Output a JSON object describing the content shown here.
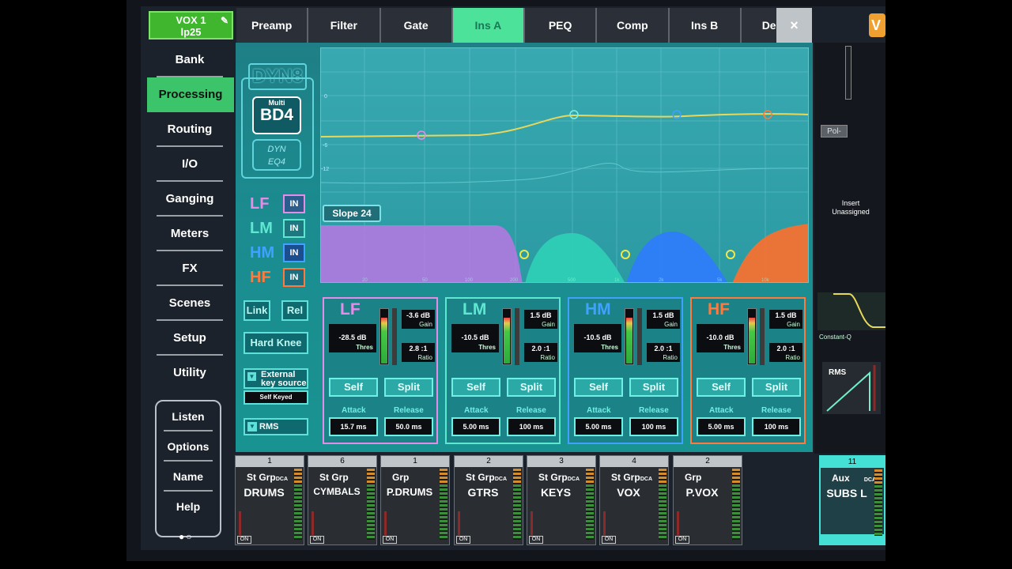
{
  "channel": {
    "name": "VOX 1",
    "sub": "lp25"
  },
  "sidebar": {
    "items": [
      {
        "label": "Bank"
      },
      {
        "label": "Processing"
      },
      {
        "label": "Routing"
      },
      {
        "label": "I/O"
      },
      {
        "label": "Ganging"
      },
      {
        "label": "Meters"
      },
      {
        "label": "FX"
      },
      {
        "label": "Scenes"
      },
      {
        "label": "Setup"
      },
      {
        "label": "Utility"
      }
    ],
    "lower": [
      {
        "label": "Listen"
      },
      {
        "label": "Options"
      },
      {
        "label": "Name"
      },
      {
        "label": "Help"
      }
    ],
    "active": "Processing"
  },
  "tabs": [
    {
      "label": "Preamp"
    },
    {
      "label": "Filter"
    },
    {
      "label": "Gate"
    },
    {
      "label": "Ins A"
    },
    {
      "label": "PEQ"
    },
    {
      "label": "Comp"
    },
    {
      "label": "Ins B"
    },
    {
      "label": "Delay"
    }
  ],
  "active_tab": "Ins A",
  "close_label": "×",
  "logos": {
    "dyn8": "DYN8",
    "multi_top": "Multi",
    "multi_main": "BD4",
    "dyneq_top": "DYN",
    "dyneq_bottom": "EQ4"
  },
  "band_toggles": [
    {
      "band": "LF",
      "state": "IN",
      "color": "#e58ce8"
    },
    {
      "band": "LM",
      "state": "IN",
      "color": "#5fe8d0"
    },
    {
      "band": "HM",
      "state": "IN",
      "color": "#3fa2ff"
    },
    {
      "band": "HF",
      "state": "IN",
      "color": "#ff7a3c"
    }
  ],
  "buttons": {
    "link": "Link",
    "rel": "Rel",
    "hard_knee": "Hard Knee",
    "external": "External key source",
    "self_keyed": "Self Keyed",
    "rms": "RMS"
  },
  "plot": {
    "slope": "Slope 24",
    "db_labels": [
      "0",
      "-6",
      "-12"
    ],
    "freq_labels": [
      "20",
      "50",
      "100",
      "200",
      "500",
      "1k",
      "2k",
      "5k",
      "10k"
    ]
  },
  "bands": [
    {
      "name": "LF",
      "color": "#e58ce8",
      "threshold": "-28.5 dB",
      "gain": "-3.6 dB",
      "ratio": "2.8 :1",
      "self": "Self",
      "split": "Split",
      "attack": "15.7 ms",
      "release": "50.0 ms"
    },
    {
      "name": "LM",
      "color": "#5fe8d0",
      "threshold": "-10.5 dB",
      "gain": "1.5 dB",
      "ratio": "2.0 :1",
      "self": "Self",
      "split": "Split",
      "attack": "5.00 ms",
      "release": "100 ms"
    },
    {
      "name": "HM",
      "color": "#3fa2ff",
      "threshold": "-10.5 dB",
      "gain": "1.5 dB",
      "ratio": "2.0 :1",
      "self": "Self",
      "split": "Split",
      "attack": "5.00 ms",
      "release": "100 ms"
    },
    {
      "name": "HF",
      "color": "#ff7a3c",
      "threshold": "-10.0 dB",
      "gain": "1.5 dB",
      "ratio": "2.0 :1",
      "self": "Self",
      "split": "Split",
      "attack": "5.00 ms",
      "release": "100 ms"
    }
  ],
  "band_labels": {
    "thres": "Thres",
    "gain": "Gain",
    "ratio": "Ratio",
    "attack": "Attack",
    "release": "Release"
  },
  "right_panel": {
    "badge": "V",
    "pol": "Pol-",
    "insert": "Insert Unassigned",
    "constant_q": "Constant-Q",
    "rms": "RMS"
  },
  "strips": [
    {
      "num": "1",
      "type": "St Grp",
      "dca": "DCA",
      "name": "DRUMS",
      "on": "ON"
    },
    {
      "num": "6",
      "type": "St Grp",
      "dca": "",
      "name": "CYMBALS",
      "on": "ON"
    },
    {
      "num": "1",
      "type": "Grp",
      "dca": "",
      "name": "P.DRUMS",
      "on": "ON"
    },
    {
      "num": "2",
      "type": "St Grp",
      "dca": "DCA",
      "name": "GTRS",
      "on": "ON"
    },
    {
      "num": "3",
      "type": "St Grp",
      "dca": "DCA",
      "name": "KEYS",
      "on": "ON"
    },
    {
      "num": "4",
      "type": "St Grp",
      "dca": "DCA",
      "name": "VOX",
      "on": "ON"
    },
    {
      "num": "2",
      "type": "Grp",
      "dca": "",
      "name": "P.VOX",
      "on": "ON"
    }
  ],
  "aux_strip": {
    "num": "11",
    "type": "Aux",
    "dca": "DCA",
    "name": "SUBS L"
  }
}
